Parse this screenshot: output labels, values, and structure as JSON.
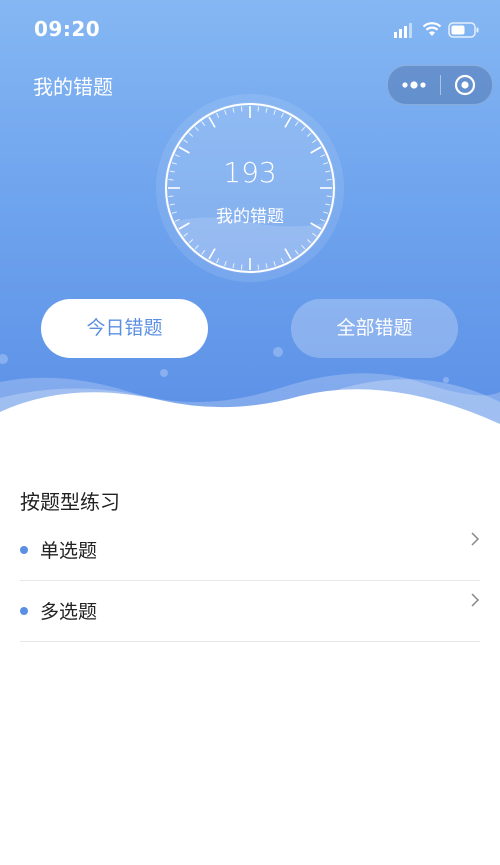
{
  "status_bar": {
    "time": "09:20",
    "icons": [
      "signal-icon",
      "wifi-icon",
      "battery-icon"
    ]
  },
  "nav": {
    "title": "我的错题",
    "capsule_icons": [
      "more-dots-icon",
      "close-target-icon"
    ]
  },
  "summary": {
    "count": "193",
    "label": "我的错题"
  },
  "buttons": {
    "today": "今日错题",
    "all": "全部错题"
  },
  "practice": {
    "section_title": "按题型练习",
    "items": [
      {
        "label": "单选题"
      },
      {
        "label": "多选题"
      }
    ]
  },
  "colors": {
    "accent": "#5b8fe3",
    "gradient_top": "#85b7f3",
    "gradient_bottom": "#5b8fe6"
  }
}
